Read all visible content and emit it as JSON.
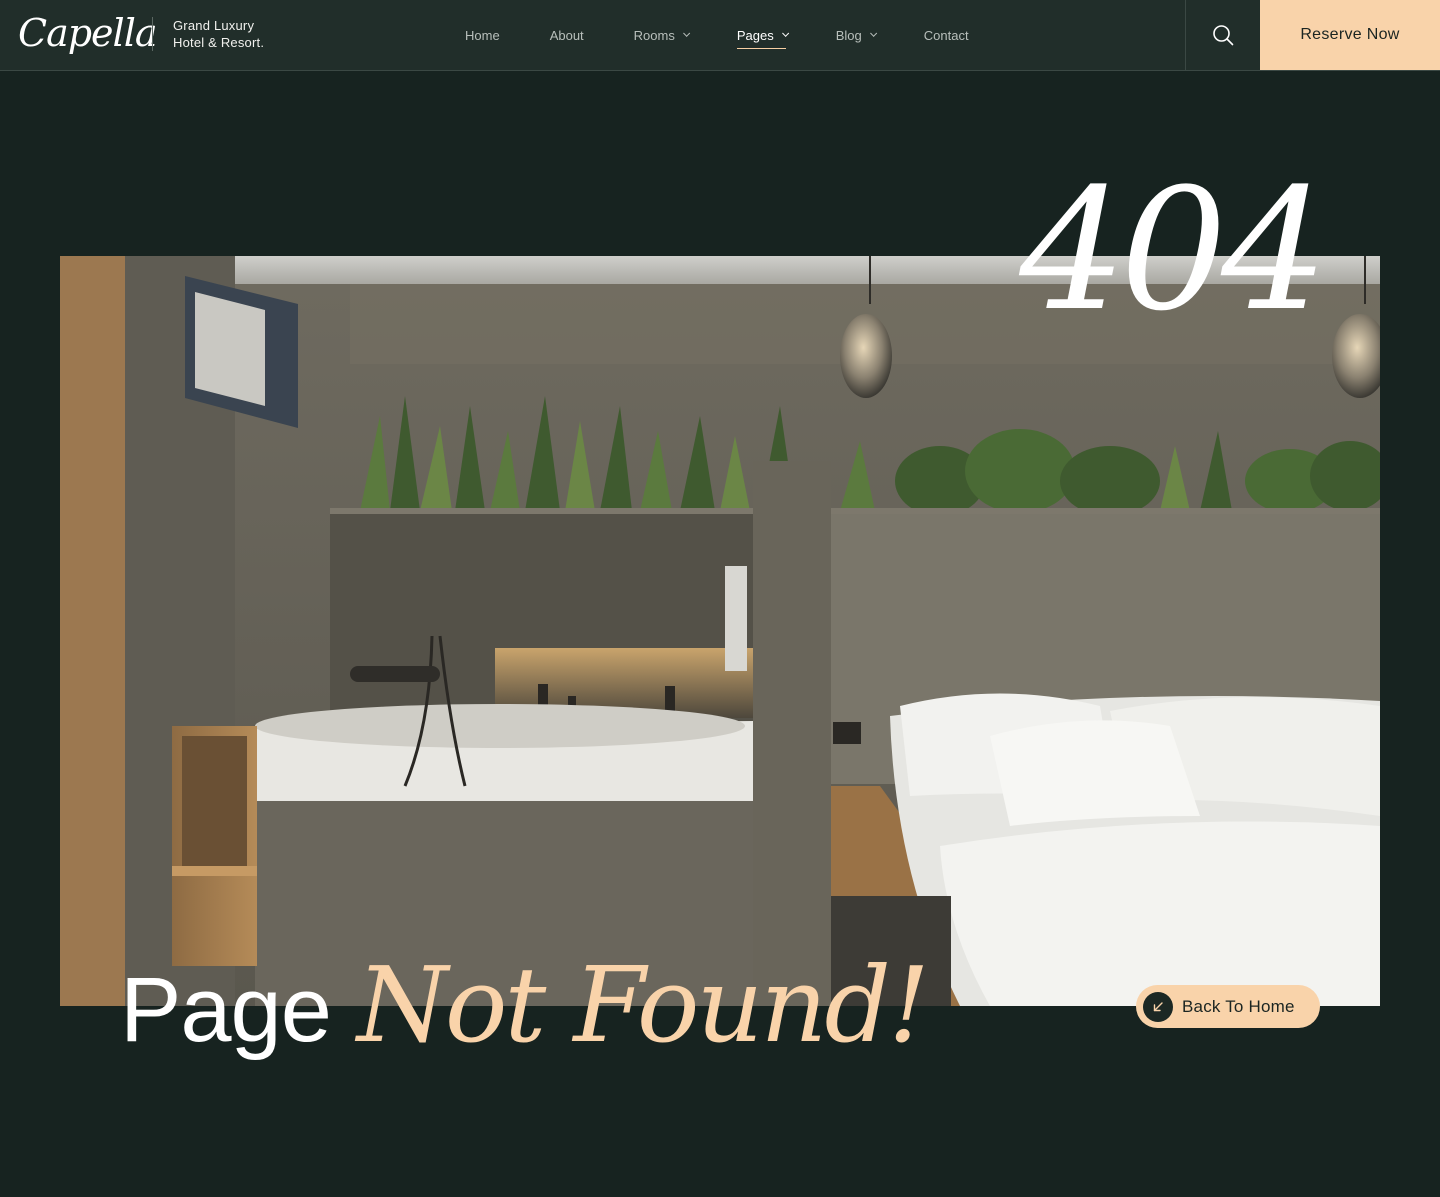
{
  "brand": {
    "logo": "Capella",
    "tagline_line1": "Grand Luxury",
    "tagline_line2": "Hotel & Resort."
  },
  "nav": {
    "items": [
      {
        "label": "Home",
        "has_dropdown": false,
        "active": false
      },
      {
        "label": "About",
        "has_dropdown": false,
        "active": false
      },
      {
        "label": "Rooms",
        "has_dropdown": true,
        "active": false
      },
      {
        "label": "Pages",
        "has_dropdown": true,
        "active": true
      },
      {
        "label": "Blog",
        "has_dropdown": true,
        "active": false
      },
      {
        "label": "Contact",
        "has_dropdown": false,
        "active": false
      }
    ]
  },
  "header": {
    "search_icon": "search-icon",
    "reserve_label": "Reserve Now"
  },
  "hero": {
    "error_code": "404",
    "headline_plain": "Page",
    "headline_accent": "Not Found!",
    "back_label": "Back To Home",
    "back_icon": "arrow-down-left-icon"
  },
  "colors": {
    "background": "#172320",
    "header": "#212e2a",
    "accent": "#f9d3aa"
  }
}
